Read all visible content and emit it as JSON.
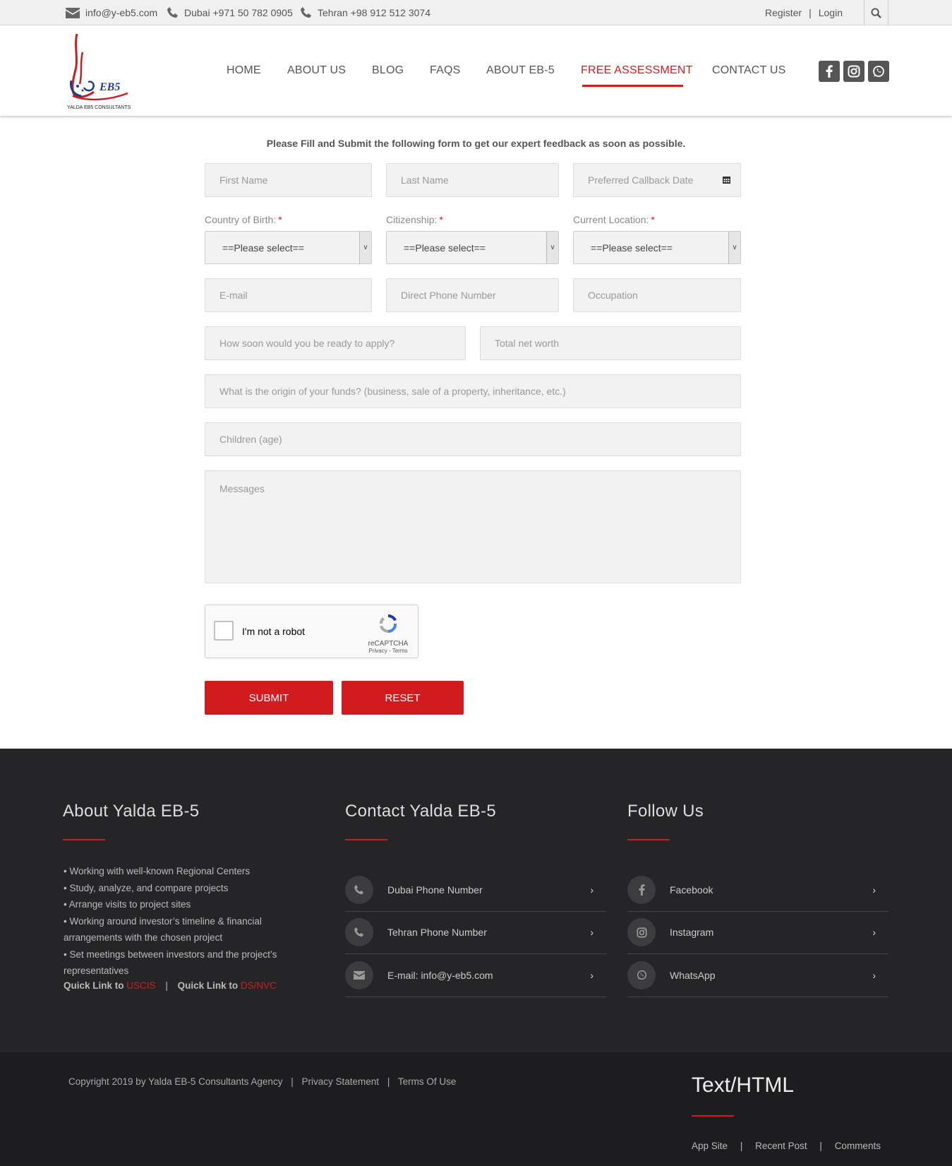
{
  "topbar": {
    "email": "info@y-eb5.com",
    "phone_dubai": "Dubai +971 50 782 0905",
    "phone_tehran": "Tehran +98 912 512 3074",
    "register": "Register",
    "separator": "|",
    "login": "Login"
  },
  "logo": {
    "brand": "EB5",
    "tagline": "YALDA EB5 CONSULTANTS"
  },
  "nav": {
    "items": [
      "HOME",
      "ABOUT US",
      "BLOG",
      "FAQS",
      "ABOUT EB-5",
      "FREE ASSESSMENT",
      "CONTACT US"
    ],
    "active": "FREE ASSESSMENT"
  },
  "social_icons": [
    "facebook-icon",
    "instagram-icon",
    "whatsapp-icon"
  ],
  "form": {
    "intro": "Please Fill and Submit the following form to get our expert feedback as soon as possible.",
    "first_name": "First Name",
    "last_name": "Last Name",
    "callback_date": "Preferred Callback Date",
    "country_label": "Country of Birth:",
    "citizenship_label": "Citizenship:",
    "location_label": "Current Location:",
    "required_mark": "*",
    "select_default": "==Please select==",
    "email": "E-mail",
    "phone": "Direct Phone Number",
    "occupation": "Occupation",
    "ready": "How soon would you be ready to apply?",
    "net_worth": "Total net worth",
    "funds_origin": "What is the origin of your funds? (business, sale of a property, inheritance, etc.)",
    "children": "Children (age)",
    "messages": "Messages",
    "captcha_text": "I'm not a robot",
    "captcha_brand": "reCAPTCHA",
    "captcha_terms": "Privacy - Terms",
    "submit": "SUBMIT",
    "reset": "RESET"
  },
  "footer": {
    "about_title": "About Yalda EB-5",
    "about_items": [
      "• Working with well-known Regional Centers",
      "• Study, analyze, and compare projects",
      "• Arrange visits to project sites",
      "• Working around investor’s timeline & financial arrangements with the chosen project",
      "• Set meetings between investors and the project’s representatives"
    ],
    "quick1_label": "Quick Link to",
    "quick1_link": "USCIS",
    "quick_sep": "|",
    "quick2_label": "Quick Link to",
    "quick2_link": "DS/NVC",
    "contact_title": "Contact Yalda EB-5",
    "contact_items": [
      "Dubai Phone Number",
      "Tehran Phone Number",
      "E-mail: info@y-eb5.com"
    ],
    "follow_title": "Follow Us",
    "follow_items": [
      "Facebook",
      "Instagram",
      "WhatsApp"
    ]
  },
  "bottom": {
    "copyright": "Copyright 2019 by Yalda EB-5 Consultants Agency",
    "sep": "|",
    "privacy": "Privacy Statement",
    "terms": "Terms Of Use",
    "widget_title": "Text/HTML",
    "links": [
      "App Site",
      "Recent Post",
      "Comments"
    ]
  },
  "colors": {
    "accent": "#d21b1f",
    "footer_bg": "#252527",
    "bottom_bg": "#1d1d1f"
  }
}
